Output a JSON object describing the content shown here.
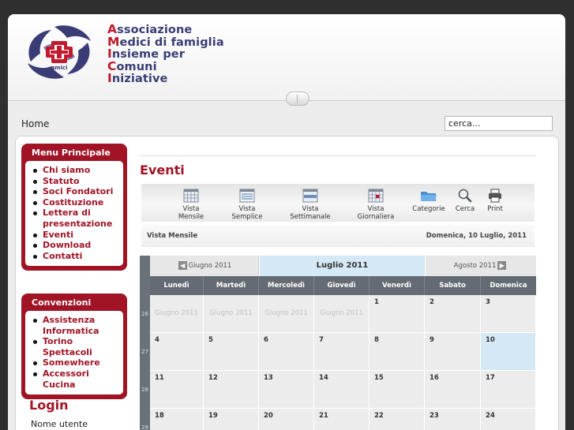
{
  "site": {
    "logo_name_lines": [
      {
        "first": "A",
        "rest": "ssociazione"
      },
      {
        "first": "M",
        "rest": "edici di famiglia"
      },
      {
        "first": "I",
        "rest": "nsieme per"
      },
      {
        "first": "C",
        "rest": "omuni"
      },
      {
        "first": "I",
        "rest": "niziative"
      }
    ],
    "logo_badge_text": "amici",
    "brand_colors": {
      "red": "#c01a2c",
      "navy": "#3a3d75",
      "module": "#a01426"
    }
  },
  "nav": {
    "home_label": "Home",
    "search_placeholder": "cerca..."
  },
  "menu_principale": {
    "title": "Menu Principale",
    "items": [
      "Chi siamo",
      "Statuto",
      "Soci Fondatori",
      "Costituzione",
      "Lettera di presentazione",
      "Eventi",
      "Download",
      "Contatti"
    ]
  },
  "convenzioni": {
    "title": "Convenzioni",
    "items": [
      "Assistenza Informatica",
      "Torino Spettacoli",
      "Somewhere",
      "Accessori Cucina"
    ]
  },
  "login": {
    "title": "Login",
    "username_label": "Nome utente"
  },
  "events": {
    "title": "Eventi",
    "toolbar": [
      {
        "label": "Vista Mensile",
        "icon": "calendar-month-icon"
      },
      {
        "label": "Vista Semplice",
        "icon": "list-icon"
      },
      {
        "label": "Vista Settimanale",
        "icon": "calendar-week-icon"
      },
      {
        "label": "Vista Giornaliera",
        "icon": "calendar-day-icon"
      },
      {
        "label": "Categorie",
        "icon": "folder-icon"
      },
      {
        "label": "Cerca",
        "icon": "magnifier-icon"
      },
      {
        "label": "Print",
        "icon": "printer-icon"
      }
    ],
    "view_label": "Vista Mensile",
    "current_date": "Domenica, 10 Luglio, 2011",
    "prev_month": "Giugno 2011",
    "current_month": "Luglio 2011",
    "next_month": "Agosto 2011",
    "weekdays": [
      "Lunedì",
      "Martedì",
      "Mercoledì",
      "Giovedì",
      "Venerdì",
      "Sabato",
      "Domenica"
    ],
    "weeks": [
      {
        "num": "26",
        "days": [
          "Giugno 2011",
          "Giugno 2011",
          "Giugno 2011",
          "Giugno 2011",
          "1",
          "2",
          "3"
        ]
      },
      {
        "num": "27",
        "days": [
          "4",
          "5",
          "6",
          "7",
          "8",
          "9",
          "10"
        ]
      },
      {
        "num": "28",
        "days": [
          "11",
          "12",
          "13",
          "14",
          "15",
          "16",
          "17"
        ]
      },
      {
        "num": "29",
        "days": [
          "18",
          "19",
          "20",
          "21",
          "22",
          "23",
          "24"
        ]
      }
    ],
    "today": "10"
  }
}
